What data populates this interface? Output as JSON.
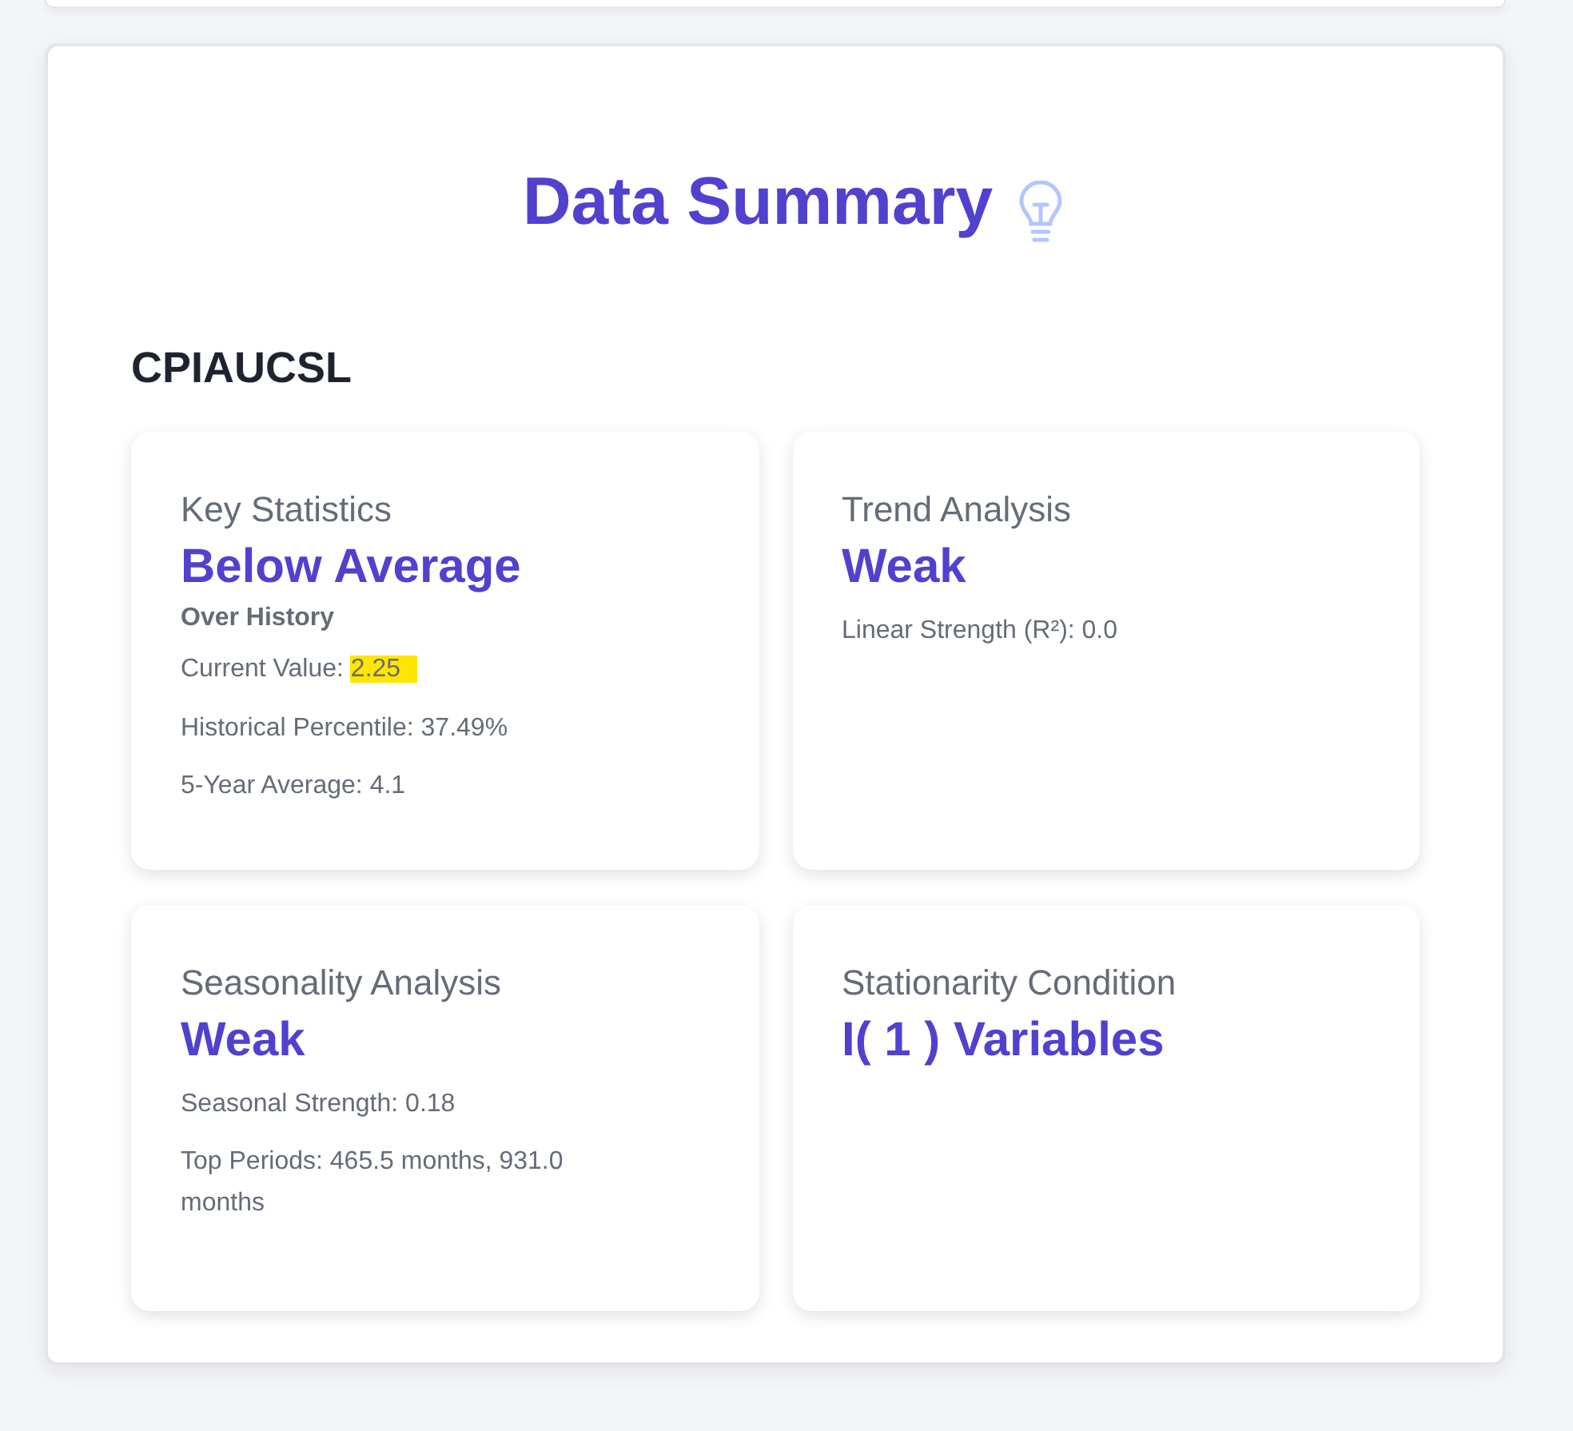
{
  "title": "Data Summary",
  "series": "CPIAUCSL",
  "cards": [
    {
      "label": "Key Statistics",
      "headline": "Below Average",
      "qualifier": "Over History",
      "lines": [
        {
          "label": "Current Value:",
          "value": "2.25",
          "highlighted": true
        },
        {
          "label": "Historical Percentile:",
          "value": "37.49%",
          "highlighted": false
        },
        {
          "label": "5-Year Average:",
          "value": "4.1",
          "highlighted": false
        }
      ]
    },
    {
      "label": "Trend Analysis",
      "headline": "Weak",
      "lines": [
        {
          "label": "Linear Strength (R²):",
          "value": "0.0",
          "highlighted": false
        }
      ]
    },
    {
      "label": "Seasonality Analysis",
      "headline": "Weak",
      "lines": [
        {
          "label": "Seasonal Strength:",
          "value": "0.18",
          "highlighted": false
        },
        {
          "label": "Top Periods:",
          "value": "465.5 months, 931.0 months",
          "highlighted": false
        }
      ]
    },
    {
      "label": "Stationarity Condition",
      "headline": "I( 1 ) Variables"
    }
  ]
}
